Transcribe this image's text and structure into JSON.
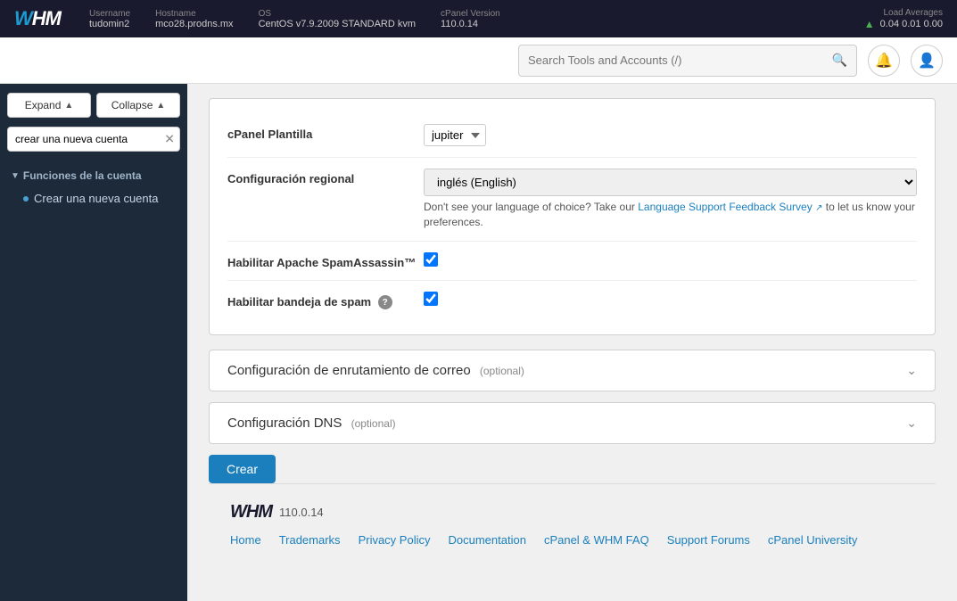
{
  "topbar": {
    "logo": "WHM",
    "username_label": "Username",
    "username_value": "tudomin2",
    "hostname_label": "Hostname",
    "hostname_value": "mco28.prodns.mx",
    "os_label": "OS",
    "os_value": "CentOS v7.9.2009 STANDARD kvm",
    "cpanel_label": "cPanel Version",
    "cpanel_value": "110.0.14",
    "load_label": "Load Averages",
    "load_values": "0.04  0.01  0.00"
  },
  "navbar": {
    "search_placeholder": "Search Tools and Accounts (/)"
  },
  "sidebar": {
    "expand_label": "Expand",
    "collapse_label": "Collapse",
    "search_value": "crear una nueva cuenta",
    "section_label": "Funciones de la cuenta",
    "item_label": "Crear una nueva cuenta"
  },
  "form": {
    "cpanel_plantilla_label": "cPanel Plantilla",
    "cpanel_plantilla_value": "jupiter",
    "configuracion_regional_label": "Configuración regional",
    "configuracion_regional_value": "inglés (English)",
    "regional_hint": "Don't see your language of choice? Take our",
    "regional_link_text": "Language Support Feedback Survey",
    "regional_hint2": "to let us know your preferences.",
    "habilitar_apache_label": "Habilitar Apache SpamAssassin™",
    "habilitar_bandeja_label": "Habilitar bandeja de spam"
  },
  "collapsible1": {
    "title": "Configuración de enrutamiento de correo",
    "optional": "(optional)"
  },
  "collapsible2": {
    "title": "Configuración DNS",
    "optional": "(optional)"
  },
  "create_button": "Crear",
  "footer": {
    "logo": "WHM",
    "version": "110.0.14",
    "links": [
      {
        "label": "Home",
        "href": "#"
      },
      {
        "label": "Trademarks",
        "href": "#"
      },
      {
        "label": "Privacy Policy",
        "href": "#"
      },
      {
        "label": "Documentation",
        "href": "#"
      },
      {
        "label": "cPanel & WHM FAQ",
        "href": "#"
      },
      {
        "label": "Support Forums",
        "href": "#"
      },
      {
        "label": "cPanel University",
        "href": "#"
      }
    ]
  }
}
